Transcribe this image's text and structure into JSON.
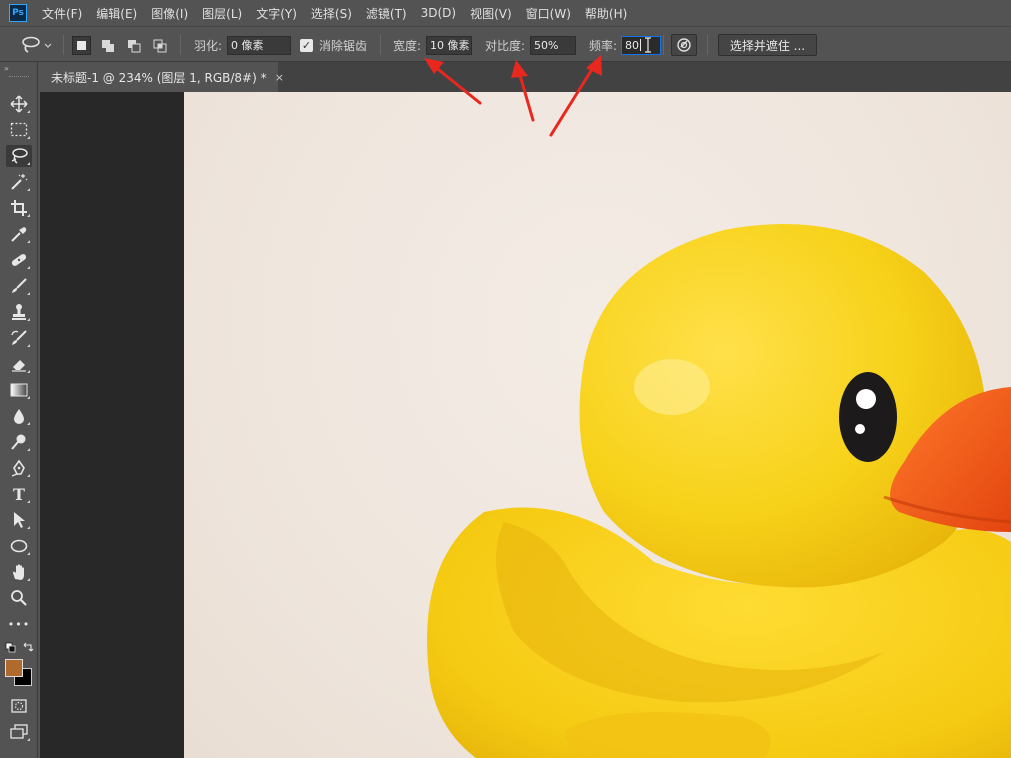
{
  "app": {
    "logo": "Ps"
  },
  "menu": [
    "文件(F)",
    "编辑(E)",
    "图像(I)",
    "图层(L)",
    "文字(Y)",
    "选择(S)",
    "滤镜(T)",
    "3D(D)",
    "视图(V)",
    "窗口(W)",
    "帮助(H)"
  ],
  "options": {
    "tool_icon": "magnetic-lasso-icon",
    "feather_label": "羽化:",
    "feather_value": "0 像素",
    "antialias_label": "消除锯齿",
    "antialias_checked": true,
    "width_label": "宽度:",
    "width_value": "10 像素",
    "contrast_label": "对比度:",
    "contrast_value": "50%",
    "frequency_label": "频率:",
    "frequency_value": "80",
    "select_mask_label": "选择并遮住 ..."
  },
  "document": {
    "tab_title": "未标题-1 @ 234% (图层 1, RGB/8#) *",
    "close_glyph": "×"
  },
  "toolbox": {
    "collapse_glyph": "»",
    "tools": [
      "move-icon",
      "marquee-icon",
      "magnetic-lasso-icon",
      "magic-wand-icon",
      "crop-icon",
      "eyedropper-icon",
      "healing-brush-icon",
      "brush-icon",
      "clone-stamp-icon",
      "history-brush-icon",
      "eraser-icon",
      "gradient-icon",
      "blur-icon",
      "dodge-icon",
      "pen-icon",
      "type-icon",
      "path-selection-icon",
      "ellipse-icon",
      "hand-icon",
      "zoom-icon",
      "more-tools-icon"
    ],
    "type_glyph": "T",
    "more_glyph": "•••",
    "foreground_color": "#b06a2d",
    "background_color": "#000000"
  },
  "colors": {
    "annotation_arrow": "#e8281e",
    "duck_yellow": "#f7d21a",
    "beak_orange": "#f0581a"
  }
}
